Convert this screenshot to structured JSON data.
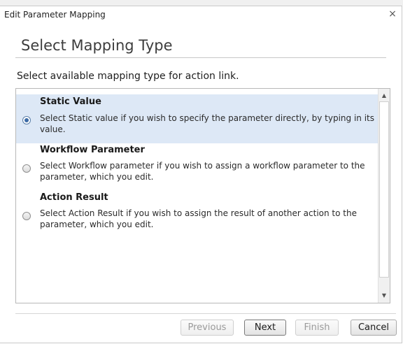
{
  "window": {
    "title": "Edit Parameter Mapping",
    "close_glyph": "×"
  },
  "page": {
    "heading": "Select Mapping Type",
    "instruction": "Select available mapping type for action link."
  },
  "options": [
    {
      "title": "Static Value",
      "description": "Select Static value if you wish to specify the parameter directly, by typing in its value.",
      "selected": true
    },
    {
      "title": "Workflow Parameter",
      "description": "Select Workflow parameter if you wish to assign a workflow parameter to the parameter, which you edit.",
      "selected": false
    },
    {
      "title": "Action Result",
      "description": "Select Action Result if you wish to assign the result of another action to the parameter, which you edit.",
      "selected": false
    }
  ],
  "scrollbar": {
    "up_glyph": "▲",
    "down_glyph": "▼"
  },
  "buttons": {
    "previous": "Previous",
    "next": "Next",
    "finish": "Finish",
    "cancel": "Cancel"
  },
  "colors": {
    "selected_row": "#dde8f6",
    "radio_dot": "#3b6aa6"
  }
}
